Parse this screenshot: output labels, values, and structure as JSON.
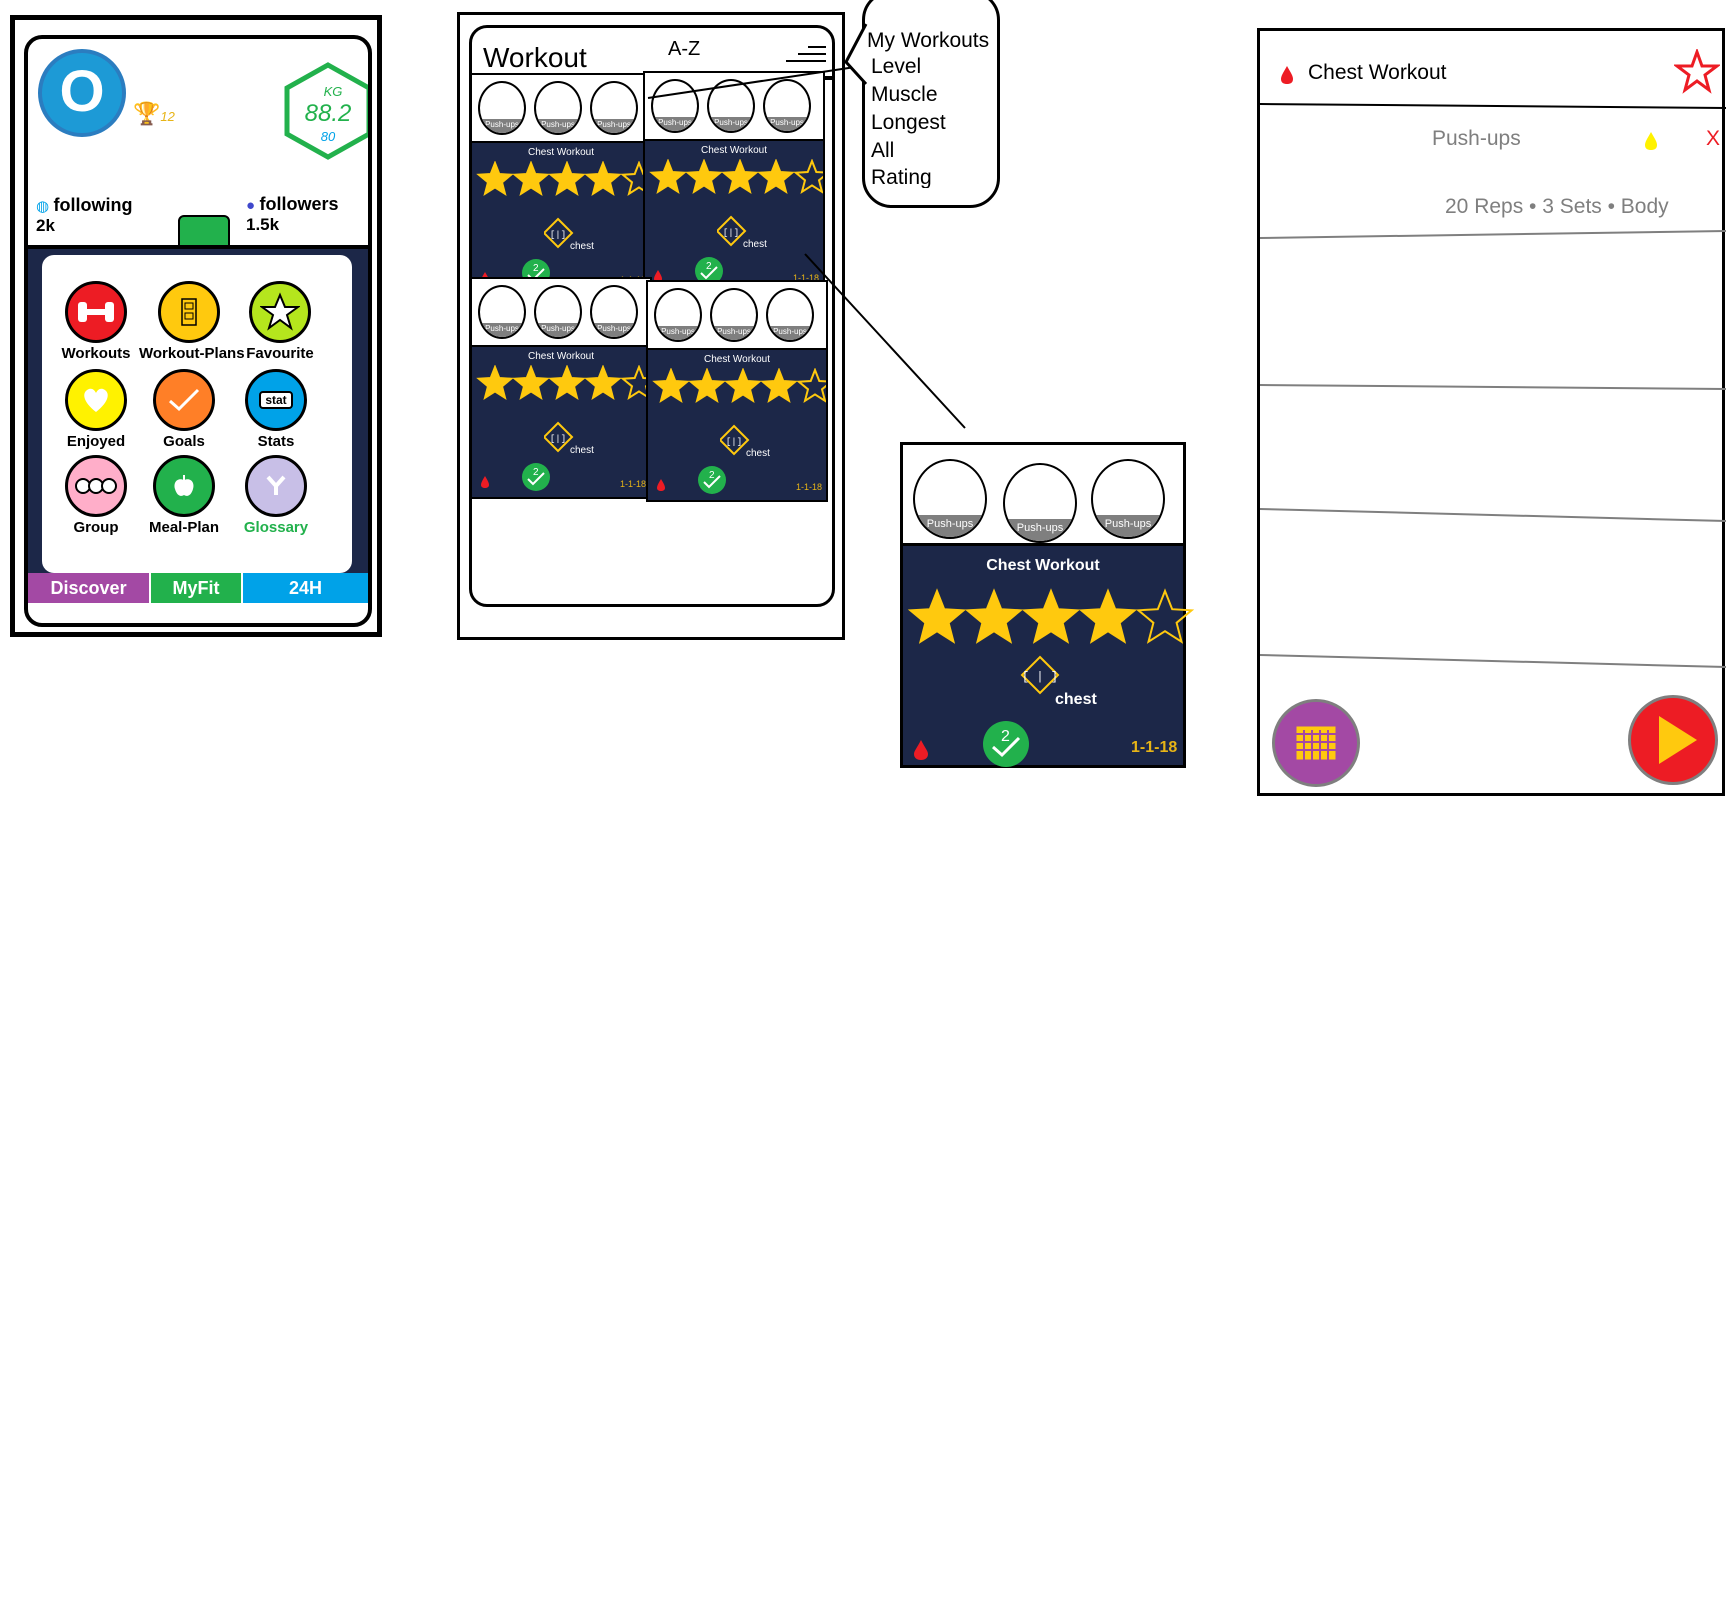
{
  "profile": {
    "avatar_letter": "O",
    "trophy_count": "12",
    "weight_unit": "KG",
    "weight_value": "88.2",
    "weight_sub": "80",
    "following_label": "following",
    "following_count": "2k",
    "followers_label": "followers",
    "followers_count": "1.5k",
    "menu": [
      {
        "label": "Workouts",
        "icon": "dumbbell-icon",
        "color": "#ed1c24"
      },
      {
        "label": "Workout-Plans",
        "icon": "clipboard-icon",
        "color": "#ffc90e"
      },
      {
        "label": "Favourite",
        "icon": "star-icon",
        "color": "#b5e61d"
      },
      {
        "label": "Enjoyed",
        "icon": "heart-icon",
        "color": "#fff200"
      },
      {
        "label": "Goals",
        "icon": "checkmark-icon",
        "color": "#ff7f27"
      },
      {
        "label": "Stats",
        "icon": "stat-icon",
        "color": "#00a2e8"
      },
      {
        "label": "Group",
        "icon": "group-icon",
        "color": "#ffaec9"
      },
      {
        "label": "Meal-Plan",
        "icon": "apple-icon",
        "color": "#22b14c"
      },
      {
        "label": "Glossary",
        "icon": "glossary-icon",
        "color": "#c8bfe7"
      }
    ],
    "stat_icon_text": "stat",
    "tabs": [
      {
        "label": "Discover",
        "color": "#a349a4"
      },
      {
        "label": "MyFit",
        "color": "#22b14c"
      },
      {
        "label": "24H",
        "color": "#00a2e8"
      }
    ]
  },
  "workout_list": {
    "title": "Workout",
    "sort_label": "A-Z",
    "card_title": "Chest Workout",
    "thumb_label": "Push-ups",
    "tag_label": "chest",
    "date": "1-1-18",
    "rating": 4,
    "rating_max": 5,
    "completed_count": "2",
    "dropdown": [
      "My Workouts",
      "Level",
      "Muscle",
      "Longest",
      "All",
      "Rating"
    ]
  },
  "card_detail": {
    "title": "Chest Workout",
    "thumb_label": "Push-ups",
    "tag_label": "chest",
    "date": "1-1-18",
    "rating": 4,
    "rating_max": 5,
    "completed_count": "2"
  },
  "workout_detail": {
    "title": "Chest Workout",
    "exercise_name": "Push-ups",
    "remove_label": "X",
    "exercise_detail": "20 Reps • 3 Sets • Body"
  },
  "colors": {
    "navy": "#1c2748",
    "star": "#ffc90e",
    "green": "#22b14c",
    "red": "#ed1c24",
    "purple": "#a349a4",
    "blue": "#00a2e8"
  }
}
